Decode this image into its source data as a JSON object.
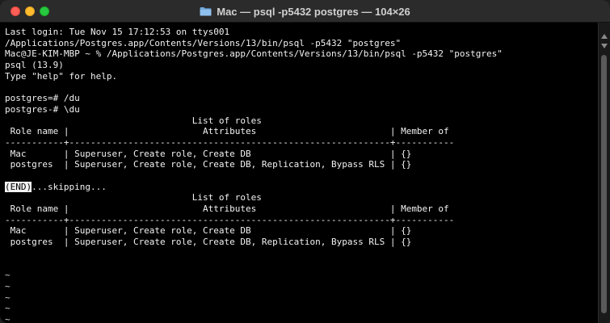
{
  "window": {
    "title": "Mac — psql -p5432 postgres — 104×26",
    "title_icon": "folder-icon"
  },
  "terminal": {
    "lines": [
      "Last login: Tue Nov 15 17:12:53 on ttys001",
      "/Applications/Postgres.app/Contents/Versions/13/bin/psql -p5432 \"postgres\"",
      "Mac@JE-KIM-MBP ~ % /Applications/Postgres.app/Contents/Versions/13/bin/psql -p5432 \"postgres\"",
      "psql (13.9)",
      "Type \"help\" for help.",
      "",
      "postgres=# /du",
      "postgres-# \\du",
      "                                   List of roles",
      " Role name |                         Attributes                         | Member of",
      "-----------+------------------------------------------------------------+-----------",
      " Mac       | Superuser, Create role, Create DB                          | {}",
      " postgres  | Superuser, Create role, Create DB, Replication, Bypass RLS | {}",
      "",
      "",
      "                                   List of roles",
      " Role name |                         Attributes                         | Member of",
      "-----------+------------------------------------------------------------+-----------",
      " Mac       | Superuser, Create role, Create DB                          | {}",
      " postgres  | Superuser, Create role, Create DB, Replication, Bypass RLS | {}",
      "",
      "",
      "~",
      "~",
      "~",
      "~",
      "~"
    ],
    "end_marker": "(END)",
    "end_suffix": "...skipping..."
  },
  "colors": {
    "background": "#000000",
    "foreground": "#f2f2f2",
    "titlebar": "#2b2b2b",
    "close": "#ff5f57",
    "minimize": "#febc2e",
    "maximize": "#28c840"
  }
}
